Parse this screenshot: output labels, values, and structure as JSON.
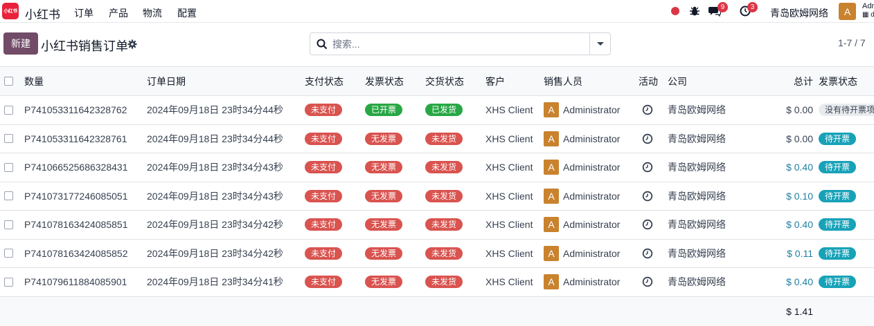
{
  "nav": {
    "logo_text": "小红书",
    "app_name": "小红书",
    "menu": [
      "订单",
      "产品",
      "物流",
      "配置"
    ],
    "chat_count": "9",
    "activity_count": "3",
    "company": "青岛欧姆网络",
    "user_initial": "A",
    "user_name": "Adm",
    "user_db": "d"
  },
  "control": {
    "new_label": "新建",
    "title": "小红书销售订单",
    "search_placeholder": "搜索...",
    "pager": "1-7 / 7"
  },
  "columns": [
    "数量",
    "订单日期",
    "支付状态",
    "发票状态",
    "交货状态",
    "客户",
    "销售人员",
    "活动",
    "公司",
    "总计",
    "发票状态"
  ],
  "rows": [
    {
      "number": "P741053311642328762",
      "date": "2024年09月18日 23时34分44秒",
      "pay": "未支付",
      "invoice": "已开票",
      "delivery": "已发货",
      "customer": "XHS Client",
      "sp_initial": "A",
      "salesperson": "Administrator",
      "company": "青岛欧姆网络",
      "total": "$ 0.00",
      "inv_status": "没有待开票项"
    },
    {
      "number": "P741053311642328761",
      "date": "2024年09月18日 23时34分44秒",
      "pay": "未支付",
      "invoice": "无发票",
      "delivery": "未发货",
      "customer": "XHS Client",
      "sp_initial": "A",
      "salesperson": "Administrator",
      "company": "青岛欧姆网络",
      "total": "$ 0.00",
      "inv_status": "待开票"
    },
    {
      "number": "P741066525686328431",
      "date": "2024年09月18日 23时34分43秒",
      "pay": "未支付",
      "invoice": "无发票",
      "delivery": "未发货",
      "customer": "XHS Client",
      "sp_initial": "A",
      "salesperson": "Administrator",
      "company": "青岛欧姆网络",
      "total": "$ 0.40",
      "inv_status": "待开票"
    },
    {
      "number": "P741073177246085051",
      "date": "2024年09月18日 23时34分43秒",
      "pay": "未支付",
      "invoice": "无发票",
      "delivery": "未发货",
      "customer": "XHS Client",
      "sp_initial": "A",
      "salesperson": "Administrator",
      "company": "青岛欧姆网络",
      "total": "$ 0.10",
      "inv_status": "待开票"
    },
    {
      "number": "P741078163424085851",
      "date": "2024年09月18日 23时34分42秒",
      "pay": "未支付",
      "invoice": "无发票",
      "delivery": "未发货",
      "customer": "XHS Client",
      "sp_initial": "A",
      "salesperson": "Administrator",
      "company": "青岛欧姆网络",
      "total": "$ 0.40",
      "inv_status": "待开票"
    },
    {
      "number": "P741078163424085852",
      "date": "2024年09月18日 23时34分42秒",
      "pay": "未支付",
      "invoice": "无发票",
      "delivery": "未发货",
      "customer": "XHS Client",
      "sp_initial": "A",
      "salesperson": "Administrator",
      "company": "青岛欧姆网络",
      "total": "$ 0.11",
      "inv_status": "待开票"
    },
    {
      "number": "P741079611884085901",
      "date": "2024年09月18日 23时34分41秒",
      "pay": "未支付",
      "invoice": "无发票",
      "delivery": "未发货",
      "customer": "XHS Client",
      "sp_initial": "A",
      "salesperson": "Administrator",
      "company": "青岛欧姆网络",
      "total": "$ 0.40",
      "inv_status": "待开票"
    }
  ],
  "grand_total": "$ 1.41",
  "colors": {
    "brand": "#714b67",
    "danger": "#d9534f",
    "success": "#28a745",
    "info": "#17a2b8",
    "avatar": "#c9822d",
    "logo": "#e8223a"
  }
}
